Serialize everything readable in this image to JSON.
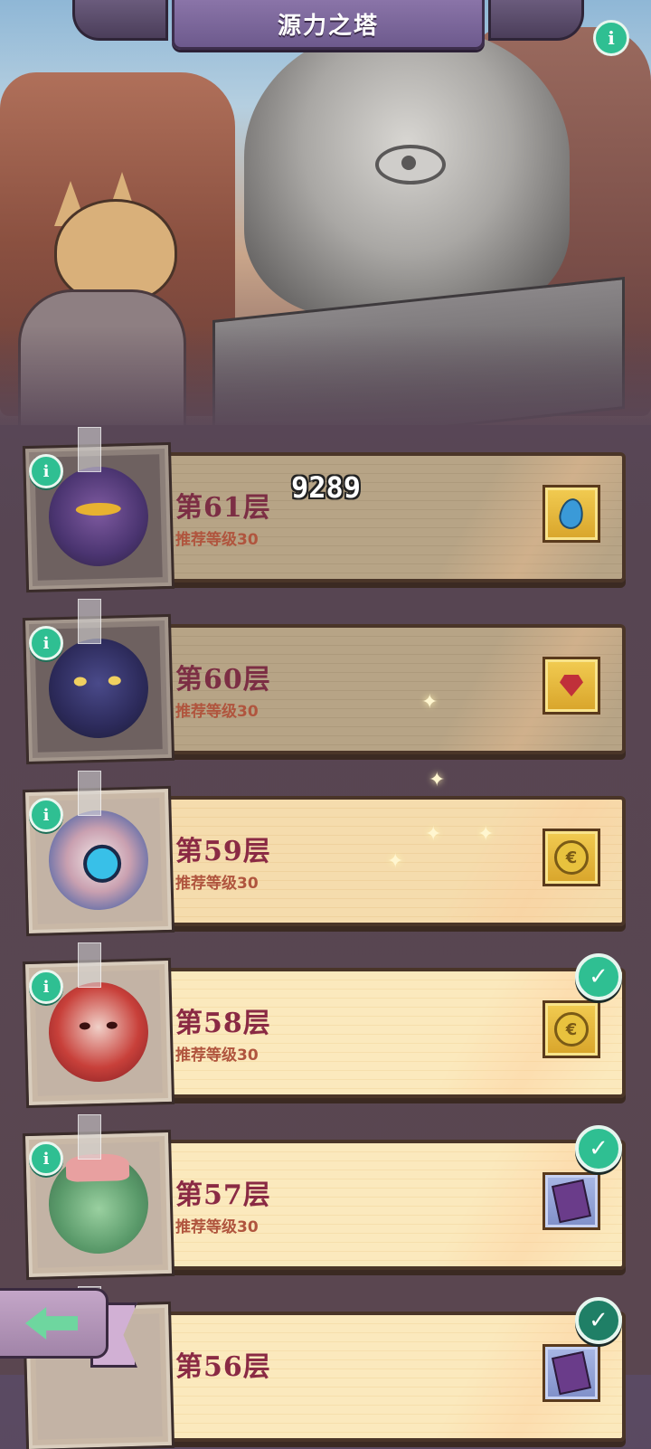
{
  "header": {
    "title": "源力之塔"
  },
  "damage_number": "9289",
  "floors": [
    {
      "title": "第61层",
      "subtitle": "推荐等级30",
      "reward_icon": "water-drop-icon",
      "cleared": false,
      "state": "dim"
    },
    {
      "title": "第60层",
      "subtitle": "推荐等级30",
      "reward_icon": "ruby-icon",
      "cleared": false,
      "state": "dim"
    },
    {
      "title": "第59层",
      "subtitle": "推荐等级30",
      "reward_icon": "gold-coin-icon",
      "cleared": false,
      "state": "current"
    },
    {
      "title": "第58层",
      "subtitle": "推荐等级30",
      "reward_icon": "gold-coin-icon",
      "cleared": true,
      "state": "lit"
    },
    {
      "title": "第57层",
      "subtitle": "推荐等级30",
      "reward_icon": "spellbook-icon",
      "cleared": true,
      "state": "lit"
    },
    {
      "title": "第56层",
      "subtitle": "",
      "reward_icon": "spellbook-icon",
      "cleared": true,
      "state": "lit"
    }
  ],
  "icons": {
    "info": "i",
    "check": "✓",
    "coin_glyph": "€"
  },
  "colors": {
    "accent_green": "#2fbf92",
    "title_red": "#8a2a44",
    "subtitle_orange": "#b0553e",
    "banner_purple": "#7a66a0"
  }
}
